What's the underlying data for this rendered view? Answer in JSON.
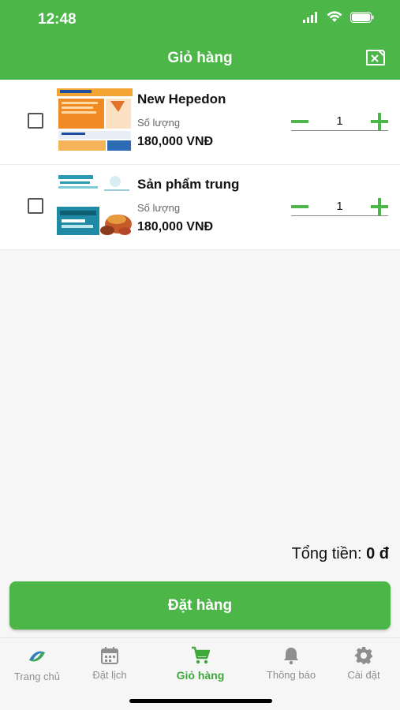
{
  "status_bar": {
    "time": "12:48"
  },
  "header": {
    "title": "Giỏ hàng"
  },
  "cart": {
    "items": [
      {
        "name": "New Hepedon",
        "quantity_label": "Số lượng",
        "quantity": "1",
        "price": "180,000 VNĐ"
      },
      {
        "name": "Sản phẩm trung",
        "quantity_label": "Số lượng",
        "quantity": "1",
        "price": "180,000 VNĐ"
      }
    ]
  },
  "summary": {
    "total_label": "Tổng tiền:",
    "total_value": "0 đ"
  },
  "order_button": {
    "label": "Đặt hàng"
  },
  "tabbar": {
    "tabs": [
      {
        "label": "Trang chủ",
        "icon": "logo-icon"
      },
      {
        "label": "Đặt lịch",
        "icon": "calendar-icon"
      },
      {
        "label": "Giỏ hàng",
        "icon": "cart-icon",
        "active": true
      },
      {
        "label": "Thông báo",
        "icon": "bell-icon"
      },
      {
        "label": "Cài đặt",
        "icon": "gear-icon"
      }
    ]
  },
  "colors": {
    "primary": "#4cb648",
    "active_tab": "#3fa83b",
    "inactive_tab": "#8e8e8e"
  }
}
